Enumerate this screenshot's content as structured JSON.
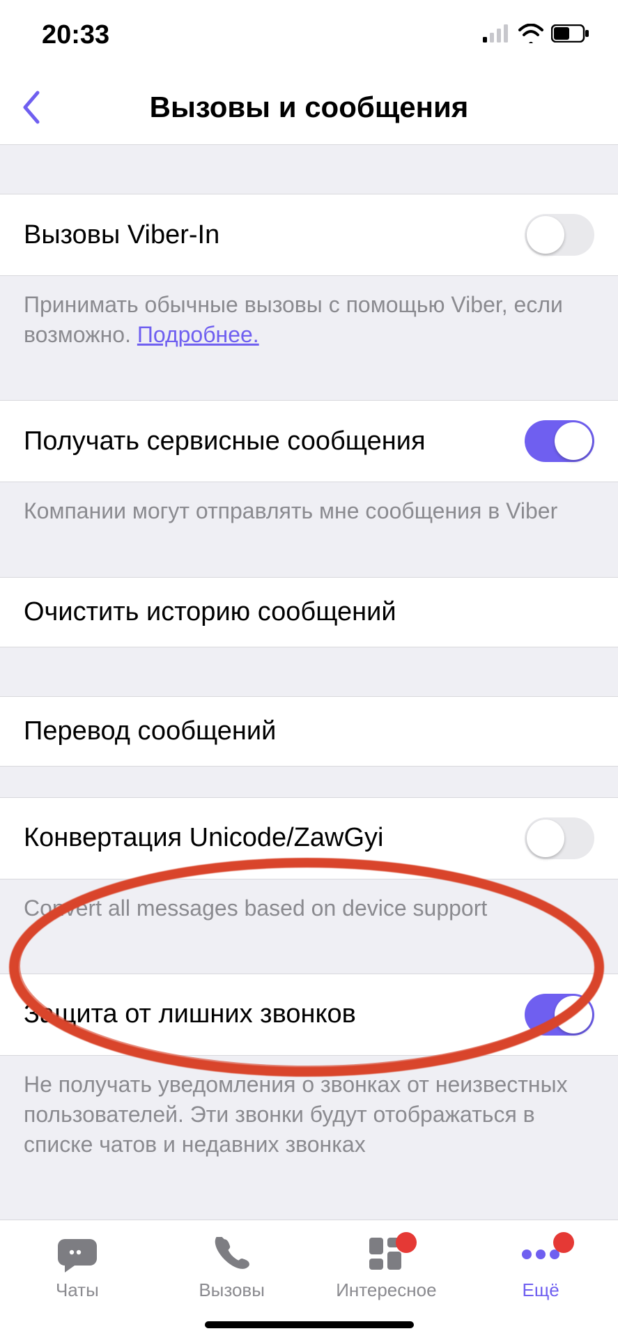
{
  "status": {
    "time": "20:33"
  },
  "nav": {
    "title": "Вызовы и сообщения"
  },
  "rows": {
    "viber_in": {
      "label": "Вызовы Viber-In",
      "on": false,
      "desc_prefix": "Принимать обычные вызовы с помощью Viber, если возможно. ",
      "desc_link": "Подробнее."
    },
    "service_msgs": {
      "label": "Получать сервисные сообщения",
      "on": true,
      "desc": "Компании могут отправлять мне сообщения в Viber"
    },
    "clear_history": {
      "label": "Очистить историю сообщений"
    },
    "translate": {
      "label": "Перевод сообщений"
    },
    "unicode": {
      "label": "Конвертация Unicode/ZawGyi",
      "on": false,
      "desc": "Convert all messages based on device support"
    },
    "call_protect": {
      "label": "Защита от лишних звонков",
      "on": true,
      "desc": "Не получать уведомления о звонках от неизвестных пользователей. Эти звонки будут отображаться в списке чатов и недавних звонках"
    }
  },
  "tabs": {
    "chats": "Чаты",
    "calls": "Вызовы",
    "explore": "Интересное",
    "more": "Ещё"
  },
  "colors": {
    "accent": "#6f5ff0",
    "annotation": "#d9452b"
  }
}
